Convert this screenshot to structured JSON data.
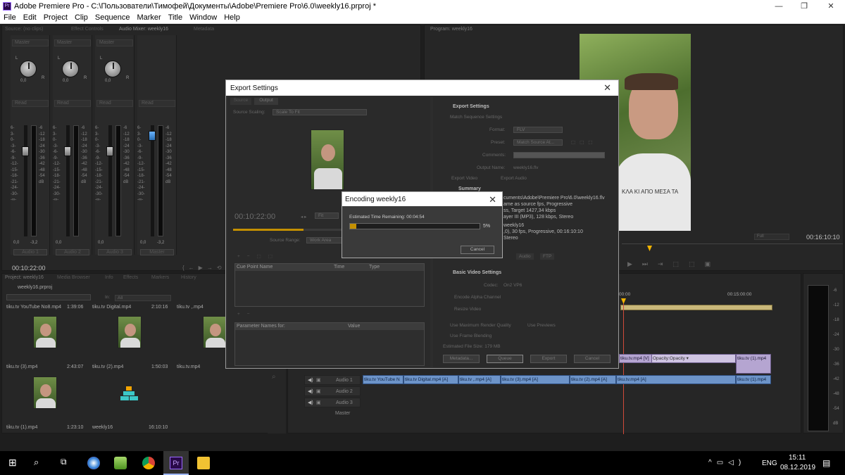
{
  "app": {
    "title": "Adobe Premiere Pro - C:\\Пользователи\\Тимофей\\Документы\\Adobe\\Premiere Pro\\6.0\\weekly16.prproj *",
    "icon_text": "Pr"
  },
  "menu": [
    "File",
    "Edit",
    "Project",
    "Clip",
    "Sequence",
    "Marker",
    "Title",
    "Window",
    "Help"
  ],
  "panels": {
    "top_tabs": [
      "Source: (no clips)",
      "Effect Controls",
      "Audio Mixer: weekly16",
      "Metadata"
    ],
    "program_tab": "Program: weekly16",
    "project_tabs": [
      "Project: weekly16",
      "Media Browser",
      "Info",
      "Effects",
      "Markers",
      "History"
    ]
  },
  "mixer": {
    "channels": [
      {
        "dropdown": "Master",
        "mode": "Read",
        "label": "Audio 1",
        "pan_l": "0,0",
        "pan_r": "-3,2"
      },
      {
        "dropdown": "Master",
        "mode": "Read",
        "label": "Audio 2",
        "pan_l": "0,0",
        "pan_r": ""
      },
      {
        "dropdown": "Master",
        "mode": "Read",
        "label": "Audio 3",
        "pan_l": "0,0",
        "pan_r": ""
      },
      {
        "dropdown": "",
        "mode": "Read",
        "label": "Master",
        "pan_l": "0,0",
        "pan_r": "-3,2"
      }
    ],
    "timecode": "00:10:22:00",
    "db_label": "dB",
    "lr": [
      "L",
      "R"
    ],
    "scale_left": "6-\n3-\n0-\n-3-\n-6-\n-9-\n-12-\n-15-\n-18-\n-21-\n-24-\n-30-\n-∞-",
    "scale_right": "-6\n-12\n-18\n-24\n-30\n-36\n-42\n-48\n-54\ndB"
  },
  "project": {
    "name": "weekly16.prproj",
    "in_label": "In:",
    "in_value": "All",
    "row0": [
      {
        "name": "tiku.tv YouTube No8.mp4",
        "dur": "1:39:06"
      },
      {
        "name": "tiku.tv Digital.mp4",
        "dur": "2:10:16"
      },
      {
        "name": "tiku.tv ,.mp4",
        "dur": ""
      }
    ],
    "row1": [
      {
        "name": "tiku.tv (3).mp4",
        "dur": "2:43:07"
      },
      {
        "name": "tiku.tv (2).mp4",
        "dur": "1:50:03"
      },
      {
        "name": "tiku.tv.mp4",
        "dur": ""
      }
    ],
    "row2": [
      {
        "name": "tiku.tv (1).mp4",
        "dur": "1:23:10"
      },
      {
        "name": "weekly16",
        "dur": "16:10:10"
      }
    ]
  },
  "program": {
    "fit": "Full",
    "timecode": "00:16:10:10"
  },
  "timeline": {
    "ruler": [
      "00:00",
      "00:15:00:00"
    ],
    "video_clips": [
      "tiku.tv.mp4 [V]",
      "Opacity:Opacity ▾",
      "tiku.tv (1).mp4"
    ],
    "audio_clips": [
      "tiku.tv YouTube N",
      "tiku.tv Digital.mp4 [A]",
      "tiku.tv ,.mp4 [A]",
      "tiku.tv (3).mp4 [A]",
      "tiku.tv (2).mp4 [A]",
      "tiku.tv.mp4 [A]",
      "tiku.tv (1).mp4"
    ],
    "tracks": [
      "Audio 1",
      "Audio 2",
      "Audio 3",
      "Master"
    ]
  },
  "export": {
    "title": "Export Settings",
    "tabs": [
      "Source",
      "Output"
    ],
    "scaling_label": "Source Scaling:",
    "scaling_value": "Scale To Fit",
    "timecode": "00:10:22:00",
    "fit": "Fit",
    "range_label": "Source Range:",
    "range_value": "Work Area",
    "cue_cols": [
      "Cue Point Name",
      "Time",
      "Type"
    ],
    "param_cols": [
      "Parameter Names for:",
      "Value"
    ],
    "settings_header": "Export Settings",
    "match_seq": "Match Sequence Settings",
    "format_label": "Format:",
    "format_value": "FLV",
    "preset_label": "Preset:",
    "preset_value": "Match Source At...",
    "comments_label": "Comments:",
    "output_label": "Output Name:",
    "output_value": "weekly16.flv",
    "export_video": "Export Video",
    "export_audio": "Export Audio",
    "summary_header": "Summary",
    "summary": [
      "cuments\\Adobe\\Premiere Pro\\6.0\\weekly16.flv",
      "ame as source fps, Progressive",
      "ss, Target 1427,34 kbps",
      "ayer III (MP3), 128 kbps, Stereo",
      "weekly16",
      ",0), 30 fps, Progressive, 00:16:10:10",
      "Stereo"
    ],
    "sub_tabs": [
      "Audio",
      "FTP"
    ],
    "basic_video": "Basic Video Settings",
    "codec_label": "Codec:",
    "codec_value": "On2 VP6",
    "encode_alpha": "Encode Alpha Channel",
    "resize": "Resize Video",
    "max_render": "Use Maximum Render Quality",
    "use_previews": "Use Previews",
    "frame_blend": "Use Frame Blending",
    "filesize": "Estimated File Size:  179 MB",
    "buttons": [
      "Metadata...",
      "Queue",
      "Export",
      "Cancel"
    ]
  },
  "encoding": {
    "title": "Encoding weekly16",
    "remaining": "Estimated Time Remaining: 00:04:54",
    "percent_text": "5%",
    "progress": 0.05,
    "cancel": "Cancel"
  },
  "taskbar": {
    "lang": "ENG",
    "time": "15:11",
    "date": "08.12.2019",
    "pr_icon": "Pr"
  }
}
